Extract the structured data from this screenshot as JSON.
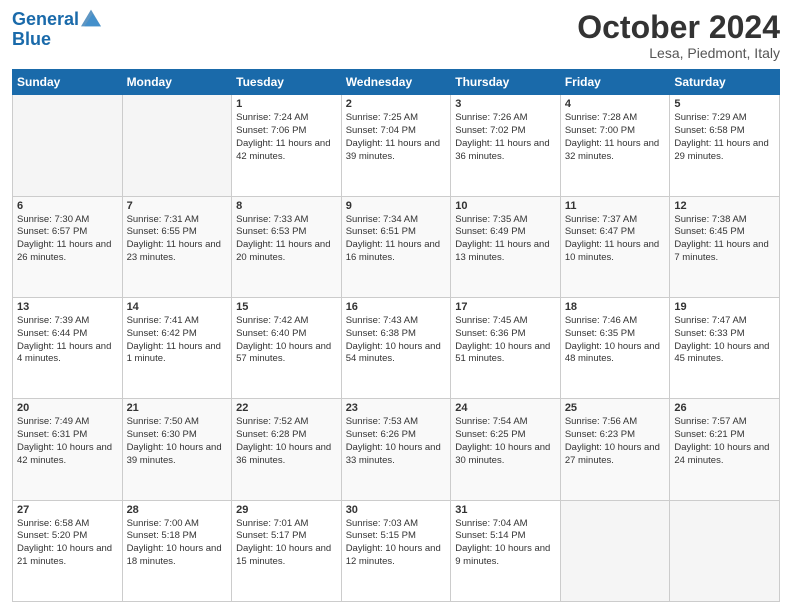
{
  "header": {
    "logo_line1": "General",
    "logo_line2": "Blue",
    "month": "October 2024",
    "location": "Lesa, Piedmont, Italy"
  },
  "days_of_week": [
    "Sunday",
    "Monday",
    "Tuesday",
    "Wednesday",
    "Thursday",
    "Friday",
    "Saturday"
  ],
  "weeks": [
    [
      {
        "day": "",
        "empty": true
      },
      {
        "day": "",
        "empty": true
      },
      {
        "day": "1",
        "sunrise": "7:24 AM",
        "sunset": "7:06 PM",
        "daylight": "11 hours and 42 minutes."
      },
      {
        "day": "2",
        "sunrise": "7:25 AM",
        "sunset": "7:04 PM",
        "daylight": "11 hours and 39 minutes."
      },
      {
        "day": "3",
        "sunrise": "7:26 AM",
        "sunset": "7:02 PM",
        "daylight": "11 hours and 36 minutes."
      },
      {
        "day": "4",
        "sunrise": "7:28 AM",
        "sunset": "7:00 PM",
        "daylight": "11 hours and 32 minutes."
      },
      {
        "day": "5",
        "sunrise": "7:29 AM",
        "sunset": "6:58 PM",
        "daylight": "11 hours and 29 minutes."
      }
    ],
    [
      {
        "day": "6",
        "sunrise": "7:30 AM",
        "sunset": "6:57 PM",
        "daylight": "11 hours and 26 minutes."
      },
      {
        "day": "7",
        "sunrise": "7:31 AM",
        "sunset": "6:55 PM",
        "daylight": "11 hours and 23 minutes."
      },
      {
        "day": "8",
        "sunrise": "7:33 AM",
        "sunset": "6:53 PM",
        "daylight": "11 hours and 20 minutes."
      },
      {
        "day": "9",
        "sunrise": "7:34 AM",
        "sunset": "6:51 PM",
        "daylight": "11 hours and 16 minutes."
      },
      {
        "day": "10",
        "sunrise": "7:35 AM",
        "sunset": "6:49 PM",
        "daylight": "11 hours and 13 minutes."
      },
      {
        "day": "11",
        "sunrise": "7:37 AM",
        "sunset": "6:47 PM",
        "daylight": "11 hours and 10 minutes."
      },
      {
        "day": "12",
        "sunrise": "7:38 AM",
        "sunset": "6:45 PM",
        "daylight": "11 hours and 7 minutes."
      }
    ],
    [
      {
        "day": "13",
        "sunrise": "7:39 AM",
        "sunset": "6:44 PM",
        "daylight": "11 hours and 4 minutes."
      },
      {
        "day": "14",
        "sunrise": "7:41 AM",
        "sunset": "6:42 PM",
        "daylight": "11 hours and 1 minute."
      },
      {
        "day": "15",
        "sunrise": "7:42 AM",
        "sunset": "6:40 PM",
        "daylight": "10 hours and 57 minutes."
      },
      {
        "day": "16",
        "sunrise": "7:43 AM",
        "sunset": "6:38 PM",
        "daylight": "10 hours and 54 minutes."
      },
      {
        "day": "17",
        "sunrise": "7:45 AM",
        "sunset": "6:36 PM",
        "daylight": "10 hours and 51 minutes."
      },
      {
        "day": "18",
        "sunrise": "7:46 AM",
        "sunset": "6:35 PM",
        "daylight": "10 hours and 48 minutes."
      },
      {
        "day": "19",
        "sunrise": "7:47 AM",
        "sunset": "6:33 PM",
        "daylight": "10 hours and 45 minutes."
      }
    ],
    [
      {
        "day": "20",
        "sunrise": "7:49 AM",
        "sunset": "6:31 PM",
        "daylight": "10 hours and 42 minutes."
      },
      {
        "day": "21",
        "sunrise": "7:50 AM",
        "sunset": "6:30 PM",
        "daylight": "10 hours and 39 minutes."
      },
      {
        "day": "22",
        "sunrise": "7:52 AM",
        "sunset": "6:28 PM",
        "daylight": "10 hours and 36 minutes."
      },
      {
        "day": "23",
        "sunrise": "7:53 AM",
        "sunset": "6:26 PM",
        "daylight": "10 hours and 33 minutes."
      },
      {
        "day": "24",
        "sunrise": "7:54 AM",
        "sunset": "6:25 PM",
        "daylight": "10 hours and 30 minutes."
      },
      {
        "day": "25",
        "sunrise": "7:56 AM",
        "sunset": "6:23 PM",
        "daylight": "10 hours and 27 minutes."
      },
      {
        "day": "26",
        "sunrise": "7:57 AM",
        "sunset": "6:21 PM",
        "daylight": "10 hours and 24 minutes."
      }
    ],
    [
      {
        "day": "27",
        "sunrise": "6:58 AM",
        "sunset": "5:20 PM",
        "daylight": "10 hours and 21 minutes."
      },
      {
        "day": "28",
        "sunrise": "7:00 AM",
        "sunset": "5:18 PM",
        "daylight": "10 hours and 18 minutes."
      },
      {
        "day": "29",
        "sunrise": "7:01 AM",
        "sunset": "5:17 PM",
        "daylight": "10 hours and 15 minutes."
      },
      {
        "day": "30",
        "sunrise": "7:03 AM",
        "sunset": "5:15 PM",
        "daylight": "10 hours and 12 minutes."
      },
      {
        "day": "31",
        "sunrise": "7:04 AM",
        "sunset": "5:14 PM",
        "daylight": "10 hours and 9 minutes."
      },
      {
        "day": "",
        "empty": true
      },
      {
        "day": "",
        "empty": true
      }
    ]
  ]
}
